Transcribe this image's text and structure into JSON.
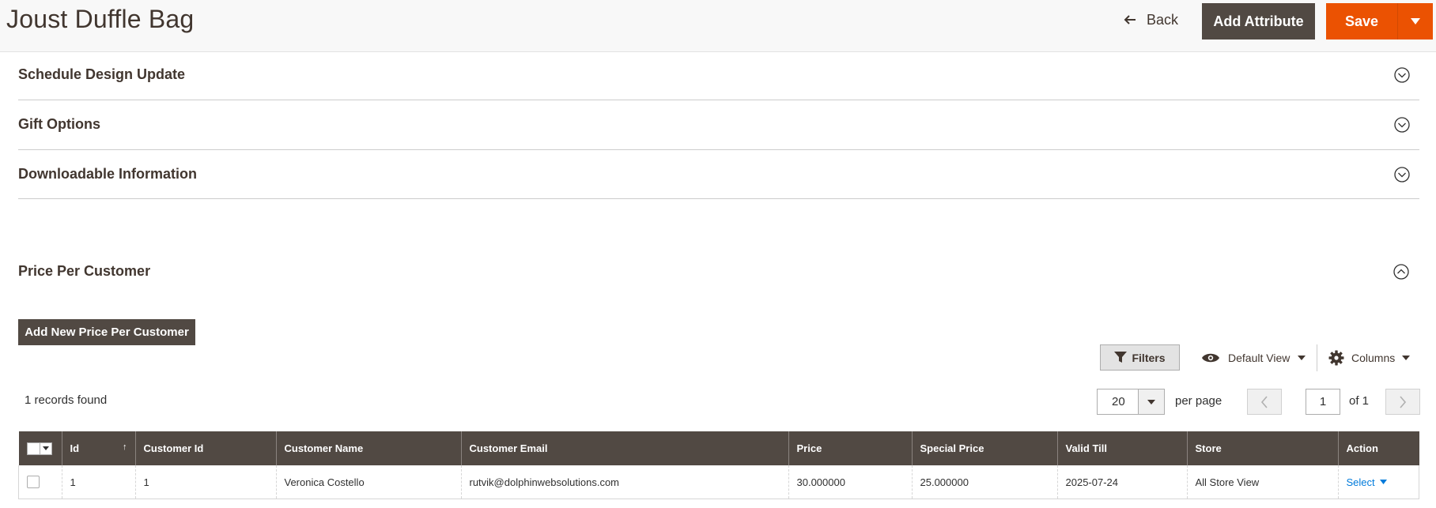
{
  "header": {
    "title": "Joust Duffle Bag",
    "back_label": "Back",
    "add_attribute_label": "Add Attribute",
    "save_label": "Save"
  },
  "sections": {
    "schedule": "Schedule Design Update",
    "gift": "Gift Options",
    "downloadable": "Downloadable Information",
    "price_per_customer": "Price Per Customer"
  },
  "grid": {
    "add_button": "Add New Price Per Customer",
    "filters_label": "Filters",
    "view_label": "Default View",
    "columns_label": "Columns",
    "records_found": "1 records found",
    "per_page_value": "20",
    "per_page_label": "per page",
    "page_value": "1",
    "page_of": "of 1",
    "columns": [
      "Id",
      "Customer Id",
      "Customer Name",
      "Customer Email",
      "Price",
      "Special Price",
      "Valid Till",
      "Store",
      "Action"
    ],
    "rows": [
      {
        "id": "1",
        "customer_id": "1",
        "customer_name": "Veronica Costello",
        "customer_email": "rutvik@dolphinwebsolutions.com",
        "price": "30.000000",
        "special_price": "25.000000",
        "valid_till": "2025-07-24",
        "store": "All Store View",
        "action": "Select"
      }
    ]
  },
  "colors": {
    "accent": "#eb5202",
    "dark": "#514943",
    "link": "#007bdb"
  }
}
